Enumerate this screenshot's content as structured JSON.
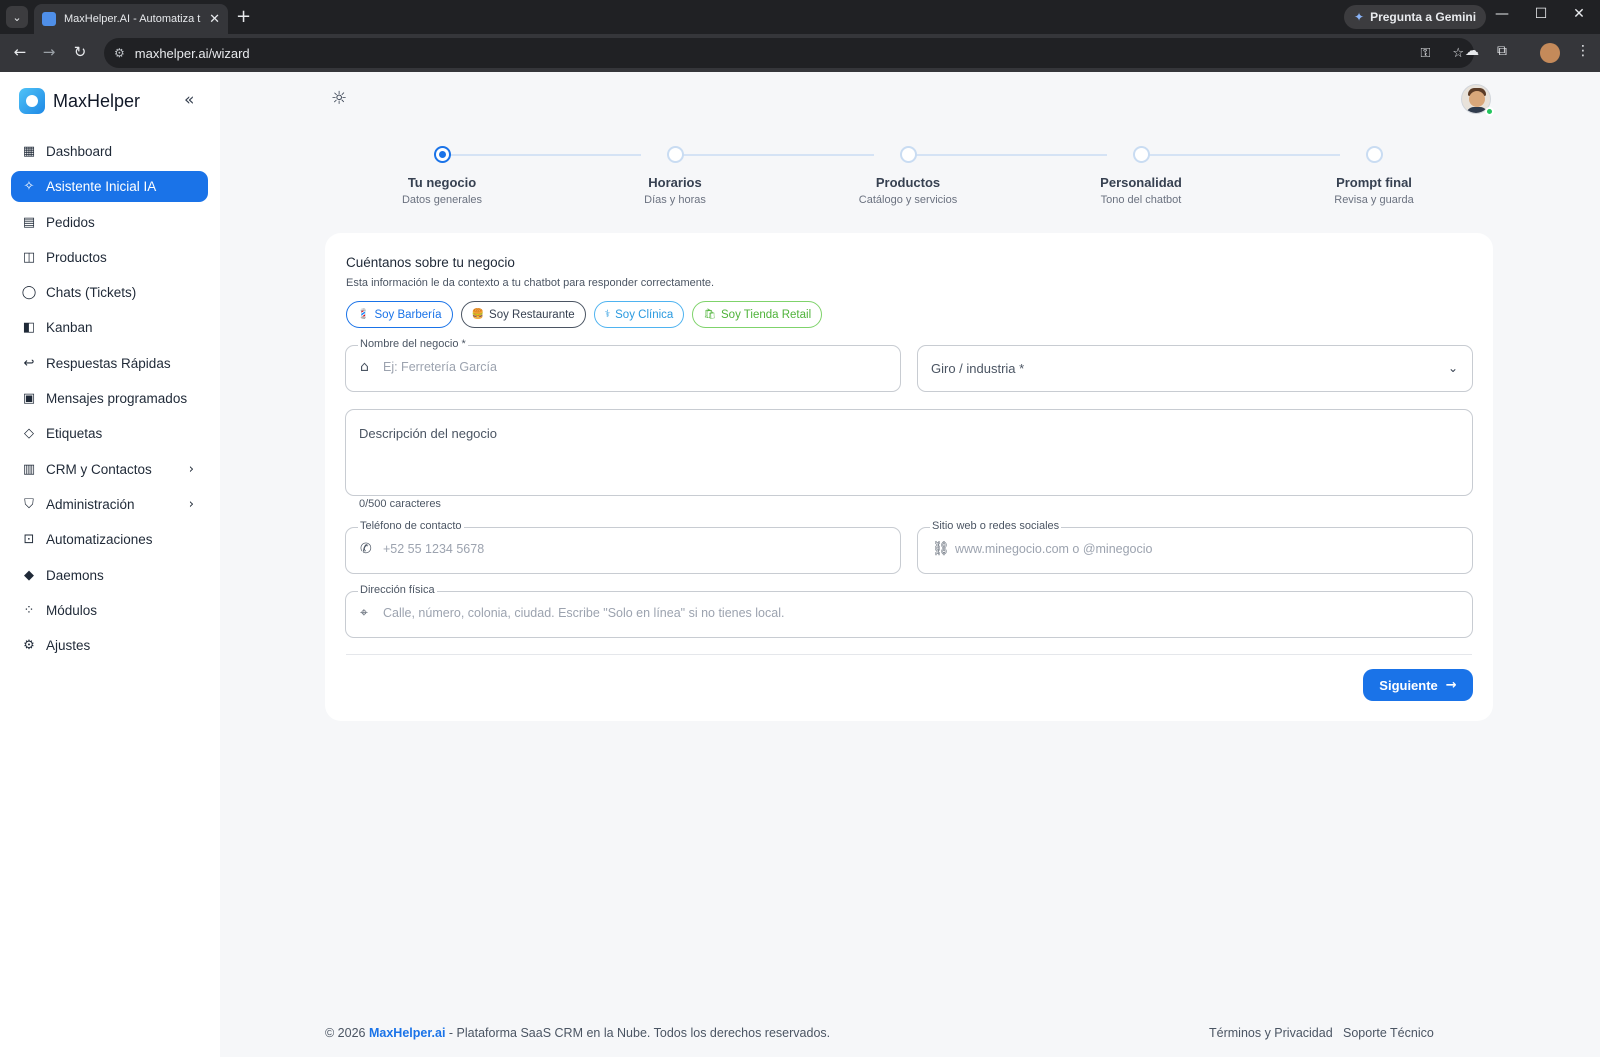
{
  "browser": {
    "tab_title": "MaxHelper.AI - Automatiza tu a",
    "gemini_label": "Pregunta a Gemini",
    "url": "maxhelper.ai/wizard"
  },
  "sidebar": {
    "brand": "MaxHelper",
    "items": [
      {
        "label": "Dashboard",
        "icon": "dashboard-icon"
      },
      {
        "label": "Asistente Inicial IA",
        "icon": "wand-icon",
        "active": true
      },
      {
        "label": "Pedidos",
        "icon": "receipt-icon"
      },
      {
        "label": "Productos",
        "icon": "shopping-bag-icon"
      },
      {
        "label": "Chats (Tickets)",
        "icon": "whatsapp-icon"
      },
      {
        "label": "Kanban",
        "icon": "kanban-icon"
      },
      {
        "label": "Respuestas Rápidas",
        "icon": "reply-all-icon"
      },
      {
        "label": "Mensajes programados",
        "icon": "calendar-icon"
      },
      {
        "label": "Etiquetas",
        "icon": "tag-icon"
      },
      {
        "label": "CRM y Contactos",
        "icon": "contacts-icon",
        "expandable": true
      },
      {
        "label": "Administración",
        "icon": "shield-user-icon",
        "expandable": true
      },
      {
        "label": "Automatizaciones",
        "icon": "robot-icon"
      },
      {
        "label": "Daemons",
        "icon": "daemon-icon"
      },
      {
        "label": "Módulos",
        "icon": "modules-icon"
      },
      {
        "label": "Ajustes",
        "icon": "gear-icon"
      }
    ]
  },
  "stepper": {
    "steps": [
      {
        "title": "Tu negocio",
        "subtitle": "Datos generales",
        "active": true
      },
      {
        "title": "Horarios",
        "subtitle": "Días y horas"
      },
      {
        "title": "Productos",
        "subtitle": "Catálogo y servicios"
      },
      {
        "title": "Personalidad",
        "subtitle": "Tono del chatbot"
      },
      {
        "title": "Prompt final",
        "subtitle": "Revisa y guarda"
      }
    ]
  },
  "form": {
    "title": "Cuéntanos sobre tu negocio",
    "subtitle": "Esta información le da contexto a tu chatbot para responder correctamente.",
    "presets": [
      {
        "label": "Soy Barbería",
        "emoji": "💈"
      },
      {
        "label": "Soy Restaurante",
        "emoji": "🍔"
      },
      {
        "label": "Soy Clínica",
        "emoji": "⚕"
      },
      {
        "label": "Soy Tienda Retail",
        "emoji": "🛍"
      }
    ],
    "business_name": {
      "label": "Nombre del negocio *",
      "placeholder": "Ej: Ferretería García",
      "value": ""
    },
    "industry": {
      "label": "Giro / industria *"
    },
    "description": {
      "label": "Descripción del negocio",
      "counter": "0/500 caracteres"
    },
    "phone": {
      "label": "Teléfono de contacto",
      "placeholder": "+52 55 1234 5678"
    },
    "website": {
      "label": "Sitio web o redes sociales",
      "placeholder": "www.minegocio.com o @minegocio"
    },
    "address": {
      "label": "Dirección física",
      "placeholder": "Calle, número, colonia, ciudad. Escribe \"Solo en línea\" si no tienes local."
    },
    "next_label": "Siguiente"
  },
  "footer": {
    "copyright": "© 2026",
    "brand": "MaxHelper.ai",
    "text": "- Plataforma SaaS CRM en la Nube. Todos los derechos reservados.",
    "links": [
      "Términos y Privacidad",
      "Soporte Técnico"
    ]
  },
  "colors": {
    "accent": "#1a73e8",
    "chrome_dark": "#202124",
    "background": "#f6f7f9"
  }
}
